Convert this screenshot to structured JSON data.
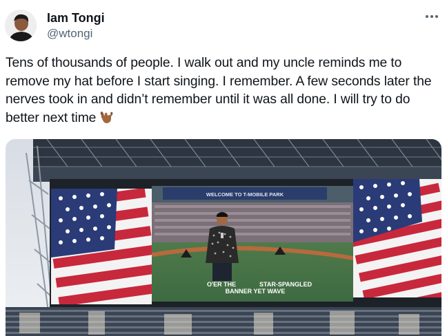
{
  "author": {
    "display_name": "Iam Tongi",
    "handle": "@wtongi"
  },
  "tweet": {
    "lines": [
      "Tens of thousands of people. I walk out and my uncle reminds me to",
      "remove my hat before I start singing. I remember. A few seconds later the",
      "nerves took in and didn’t remember until it was all done. I will try to do",
      "better next time"
    ],
    "emoji": "call-me-hand-emoji"
  },
  "media": {
    "scoreboard_caption": "WELCOME TO T-MOBILE PARK",
    "lyric_line_1": "O'ER THE",
    "lyric_line_1b": "STAR-SPANGLED",
    "lyric_line_2": "BANNER YET WAVE"
  },
  "icons": {
    "more": "more-options-icon"
  },
  "colors": {
    "text_primary": "#0f1419",
    "text_secondary": "#536471",
    "flag_red": "#c8283c",
    "flag_blue": "#2a3b78",
    "stadium_dark": "#2d3540"
  }
}
